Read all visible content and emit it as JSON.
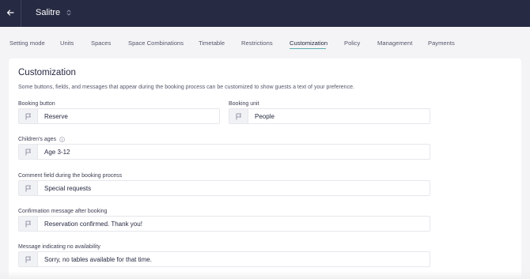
{
  "header": {
    "venue_name": "Salitre",
    "back_icon": "arrow-left-icon",
    "switch_icon": "chevron-up-down-icon"
  },
  "tabs": [
    {
      "label": "Setting mode",
      "active": false
    },
    {
      "label": "Units",
      "active": false
    },
    {
      "label": "Spaces",
      "active": false
    },
    {
      "label": "Space Combinations",
      "active": false
    },
    {
      "label": "Timetable",
      "active": false
    },
    {
      "label": "Restrictions",
      "active": false
    },
    {
      "label": "Customization",
      "active": true
    },
    {
      "label": "Policy",
      "active": false
    },
    {
      "label": "Management",
      "active": false
    },
    {
      "label": "Payments",
      "active": false
    }
  ],
  "customization": {
    "title": "Customization",
    "description": "Some buttons, fields, and messages that appear during the booking process can be customized to show guests a text of your preference.",
    "fields": {
      "booking_button": {
        "label": "Booking button",
        "value": "Reserve"
      },
      "booking_unit": {
        "label": "Booking unit",
        "value": "People"
      },
      "childrens_ages": {
        "label": "Children's ages",
        "value": "Age 3-12"
      },
      "comment_field": {
        "label": "Comment field during the booking process",
        "value": "Special requests"
      },
      "confirmation_message": {
        "label": "Confirmation message after booking",
        "value": "Reservation confirmed. Thank you!"
      },
      "no_availability": {
        "label": "Message indicating no availability",
        "value": "Sorry, no tables available for that time."
      }
    }
  },
  "colors": {
    "topbar": "#262a42",
    "accent_underline": "#5fb0b0",
    "background": "#f4f4f6"
  }
}
